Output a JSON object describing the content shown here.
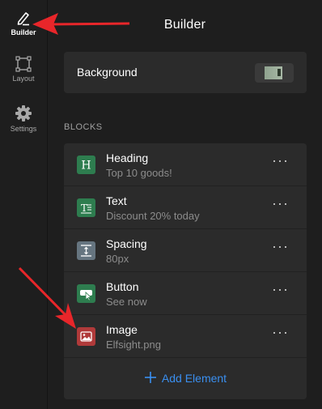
{
  "sidebar": {
    "items": [
      {
        "label": "Builder",
        "icon": "pen-icon",
        "active": true
      },
      {
        "label": "Layout",
        "icon": "layout-frame-icon",
        "active": false
      },
      {
        "label": "Settings",
        "icon": "gear-icon",
        "active": false
      }
    ]
  },
  "header": {
    "title": "Builder"
  },
  "background_row": {
    "label": "Background"
  },
  "blocks_section": {
    "heading": "BLOCKS",
    "items": [
      {
        "name": "Heading",
        "subtitle": "Top 10 goods!",
        "icon": "heading-icon",
        "icon_color": "#2e7d4f"
      },
      {
        "name": "Text",
        "subtitle": "Discount 20% today",
        "icon": "text-icon",
        "icon_color": "#2e7d4f"
      },
      {
        "name": "Spacing",
        "subtitle": "80px",
        "icon": "spacing-icon",
        "icon_color": "#667580"
      },
      {
        "name": "Button",
        "subtitle": "See now",
        "icon": "button-icon",
        "icon_color": "#2e7d4f"
      },
      {
        "name": "Image",
        "subtitle": "Elfsight.png",
        "icon": "image-icon",
        "icon_color": "#b03a3a"
      }
    ],
    "more_glyph": "···",
    "add_label": "Add Element"
  },
  "colors": {
    "accent": "#3a8ff0",
    "annotation": "#e8262a"
  }
}
